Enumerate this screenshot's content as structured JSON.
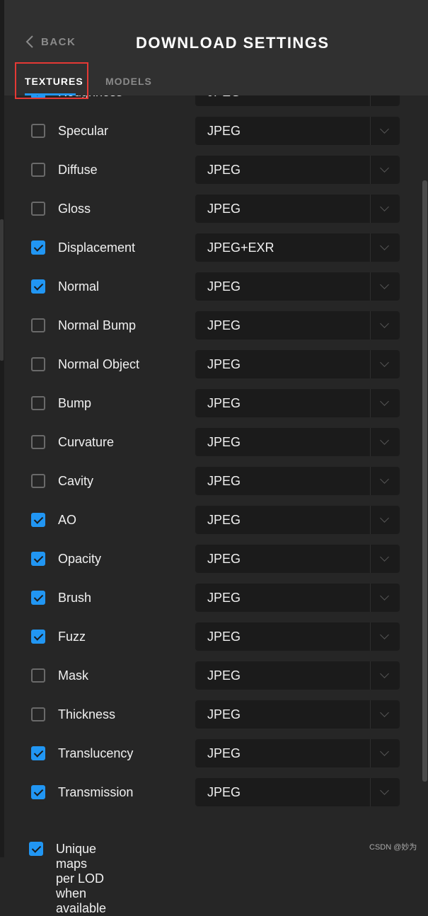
{
  "header": {
    "back_label": "BACK",
    "title": "DOWNLOAD SETTINGS"
  },
  "tabs": [
    {
      "label": "TEXTURES",
      "active": true
    },
    {
      "label": "MODELS",
      "active": false
    }
  ],
  "accent_color": "#2196f3",
  "textures": [
    {
      "label": "Roughness",
      "checked": true,
      "format": "JPEG"
    },
    {
      "label": "Specular",
      "checked": false,
      "format": "JPEG"
    },
    {
      "label": "Diffuse",
      "checked": false,
      "format": "JPEG"
    },
    {
      "label": "Gloss",
      "checked": false,
      "format": "JPEG"
    },
    {
      "label": "Displacement",
      "checked": true,
      "format": "JPEG+EXR"
    },
    {
      "label": "Normal",
      "checked": true,
      "format": "JPEG"
    },
    {
      "label": "Normal Bump",
      "checked": false,
      "format": "JPEG"
    },
    {
      "label": "Normal Object",
      "checked": false,
      "format": "JPEG"
    },
    {
      "label": "Bump",
      "checked": false,
      "format": "JPEG"
    },
    {
      "label": "Curvature",
      "checked": false,
      "format": "JPEG"
    },
    {
      "label": "Cavity",
      "checked": false,
      "format": "JPEG"
    },
    {
      "label": "AO",
      "checked": true,
      "format": "JPEG"
    },
    {
      "label": "Opacity",
      "checked": true,
      "format": "JPEG"
    },
    {
      "label": "Brush",
      "checked": true,
      "format": "JPEG"
    },
    {
      "label": "Fuzz",
      "checked": true,
      "format": "JPEG"
    },
    {
      "label": "Mask",
      "checked": false,
      "format": "JPEG"
    },
    {
      "label": "Thickness",
      "checked": false,
      "format": "JPEG"
    },
    {
      "label": "Translucency",
      "checked": true,
      "format": "JPEG"
    },
    {
      "label": "Transmission",
      "checked": true,
      "format": "JPEG"
    }
  ],
  "lod_option": {
    "label": "Unique maps per LOD when available",
    "checked": true
  },
  "watermark": "CSDN @妙为"
}
